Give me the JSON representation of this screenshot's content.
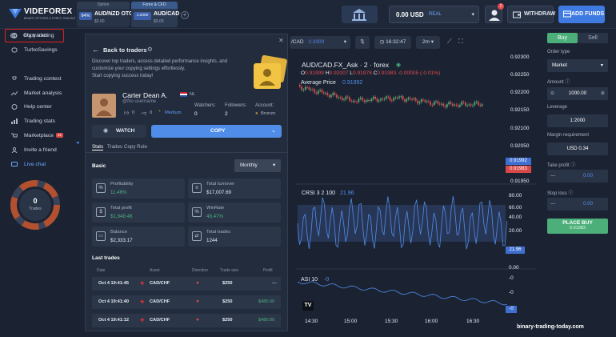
{
  "brand": {
    "name": "VIDEFOREX",
    "tagline": "BINARY OPTIONS & FOREX TRADING"
  },
  "tabs": {
    "option": {
      "header": "Option",
      "pct": "84%",
      "pair": "AUD/NZD OTC",
      "sub": "$0.00"
    },
    "forex": {
      "header": "Forex & CFD",
      "pct": "1:2000",
      "pair": "AUD/CAD",
      "sub": "$0.00"
    }
  },
  "balance": {
    "value": "0.00 USD",
    "type": "REAL"
  },
  "notifications": "2",
  "header_buttons": {
    "withdraw": "WITHDRAW",
    "add_funds": "ADD FUNDS"
  },
  "sidebar": {
    "items": [
      {
        "label": "My trades"
      },
      {
        "label": "TurboSavings"
      },
      {
        "label": "Copy trading"
      },
      {
        "label": "Trading contest"
      },
      {
        "label": "Market analysis"
      },
      {
        "label": "Help center"
      },
      {
        "label": "Trading stats"
      },
      {
        "label": "Marketplace",
        "badge": "11"
      },
      {
        "label": "Invite a friend"
      },
      {
        "label": "Live chat"
      }
    ],
    "ring": {
      "count": "0",
      "label": "Trades"
    }
  },
  "panel": {
    "back": "Back to traders",
    "intro": [
      "Discover top traders, access detailed performance insights, and",
      "customize your copying settings effortlessly.",
      "Start copying success today!"
    ],
    "trader": {
      "name": "Carter Dean A.",
      "country": "NL",
      "username": "@No username",
      "likes": "0",
      "dislikes": "0",
      "level": "Medium",
      "watchers_label": "Watchers:",
      "watchers": "0",
      "followers_label": "Followers:",
      "followers": "2",
      "account_label": "Account:",
      "account": "Bronze"
    },
    "watch": "WATCH",
    "copy": "COPY",
    "subtabs": [
      "Stats",
      "Trades",
      "Copy Rule"
    ],
    "basic": "Basic",
    "period": "Monthly",
    "stats": [
      {
        "k": "Profitability",
        "v": "11.46%",
        "color": "#4caf7a"
      },
      {
        "k": "Total turnover",
        "v": "$17,007.69",
        "color": "#e6ebf2"
      },
      {
        "k": "Total profit",
        "v": "$1,948.46",
        "color": "#4caf7a"
      },
      {
        "k": "WinRate",
        "v": "48.47%",
        "color": "#4caf7a"
      },
      {
        "k": "Balance",
        "v": "$2,333.17",
        "color": "#e6ebf2"
      },
      {
        "k": "Total trades",
        "v": "1244",
        "color": "#e6ebf2"
      }
    ],
    "last_trades": "Last trades",
    "columns": [
      "Date",
      "Asset",
      "Direction",
      "Trade size",
      "Profit"
    ],
    "rows": [
      {
        "date": "Oct 4 19:41:45",
        "asset": "CAD/CHF",
        "size": "$250",
        "profit": "—"
      },
      {
        "date": "Oct 4 19:41:40",
        "asset": "CAD/CHF",
        "size": "$250",
        "profit": "$480.00"
      },
      {
        "date": "Oct 4 19:41:12",
        "asset": "CAD/CHF",
        "size": "$250",
        "profit": "$480.00"
      }
    ]
  },
  "chart": {
    "pair_btn": "/CAD",
    "leverage_btn": "1:2000",
    "clock": "16:32:47",
    "interval": "2m",
    "title": "AUD/CAD.FX_Ask · 2 · forex",
    "ohlc": {
      "o": "0.91999",
      "h": "0.92007",
      "l": "0.91978",
      "c": "0.91983",
      "chg": "-0.00005 (-0.01%)"
    },
    "avg_label": "Average Price",
    "avg_value": "0.91992",
    "price_ticks": [
      "0.92300",
      "0.92250",
      "0.92200",
      "0.92150",
      "0.92100",
      "0.92050",
      "0.91950"
    ],
    "tag_up": "0.91992",
    "tag_down": "0.91983",
    "crsi_label": "CRSI 3 2 100",
    "crsi_value": "21.96",
    "crsi_ticks": [
      "80.00",
      "60.00",
      "40.00",
      "20.00",
      "0.00"
    ],
    "crsi_tag": "21.96",
    "asi_label": "ASI 10",
    "asi_value": "-0",
    "asi_ticks": [
      "-0",
      "-0",
      "-0"
    ],
    "asi_tag": "-0",
    "time_ticks": [
      "14:30",
      "15:00",
      "15:30",
      "16:00",
      "16:30"
    ]
  },
  "trade": {
    "buy": "Buy",
    "sell": "Sell",
    "order_type_label": "Order type",
    "order_type": "Market",
    "amount_label": "Amount",
    "amount": "1000.00",
    "leverage_label": "Leverage",
    "leverage": "1:2000",
    "margin_label": "Margin requirement",
    "margin": "USD 0.34",
    "tp_label": "Take profit",
    "tp": "0.00",
    "sl_label": "Stop loss",
    "sl": "0.00",
    "place": "PLACE BUY",
    "place_price": "0.91983"
  },
  "watermark": "binary-trading-today.com"
}
